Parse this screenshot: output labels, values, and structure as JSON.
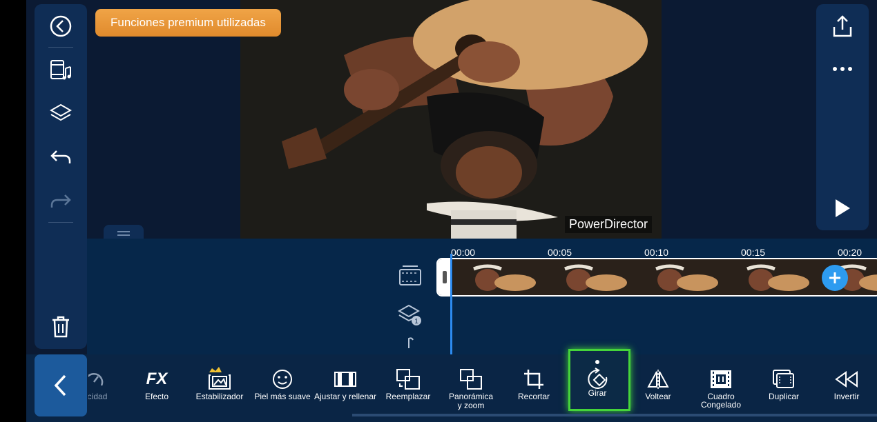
{
  "banner": {
    "premium_label": "Funciones premium utilizadas"
  },
  "preview": {
    "watermark": "PowerDirector"
  },
  "left_toolbar": {
    "items": [
      {
        "name": "back-icon"
      },
      {
        "name": "media-library-icon"
      },
      {
        "name": "layers-icon"
      },
      {
        "name": "undo-icon"
      },
      {
        "name": "redo-icon"
      },
      {
        "name": "delete-icon"
      }
    ]
  },
  "right_toolbar": {
    "items": [
      {
        "name": "export-icon"
      },
      {
        "name": "more-options-icon"
      },
      {
        "name": "play-icon"
      }
    ]
  },
  "timeline": {
    "ruler": [
      "00:00",
      "00:05",
      "00:10",
      "00:15",
      "00:20"
    ],
    "layer_badge": "1"
  },
  "edit_toolbar": {
    "tools": [
      {
        "label": "ocidad",
        "icon": "speed-icon"
      },
      {
        "label": "Efecto",
        "icon": "fx-icon",
        "icon_text": "FX"
      },
      {
        "label": "Estabilizador",
        "icon": "stabilizer-icon"
      },
      {
        "label": "Piel más suave",
        "icon": "smooth-skin-icon"
      },
      {
        "label": "Ajustar y rellenar",
        "icon": "fit-fill-icon"
      },
      {
        "label": "Reemplazar",
        "icon": "replace-icon"
      },
      {
        "label": "Panorámica y zoom",
        "icon": "pan-zoom-icon"
      },
      {
        "label": "Recortar",
        "icon": "crop-icon"
      },
      {
        "label": "Girar",
        "icon": "rotate-icon",
        "selected": true
      },
      {
        "label": "Voltear",
        "icon": "flip-icon"
      },
      {
        "label": "Cuadro Congelado",
        "icon": "freeze-frame-icon"
      },
      {
        "label": "Duplicar",
        "icon": "duplicate-icon"
      },
      {
        "label": "Invertir",
        "icon": "reverse-icon"
      }
    ]
  },
  "colors": {
    "accent": "#2d8bf0",
    "premium": "#e8952f",
    "selected_outline": "#45d43a"
  }
}
